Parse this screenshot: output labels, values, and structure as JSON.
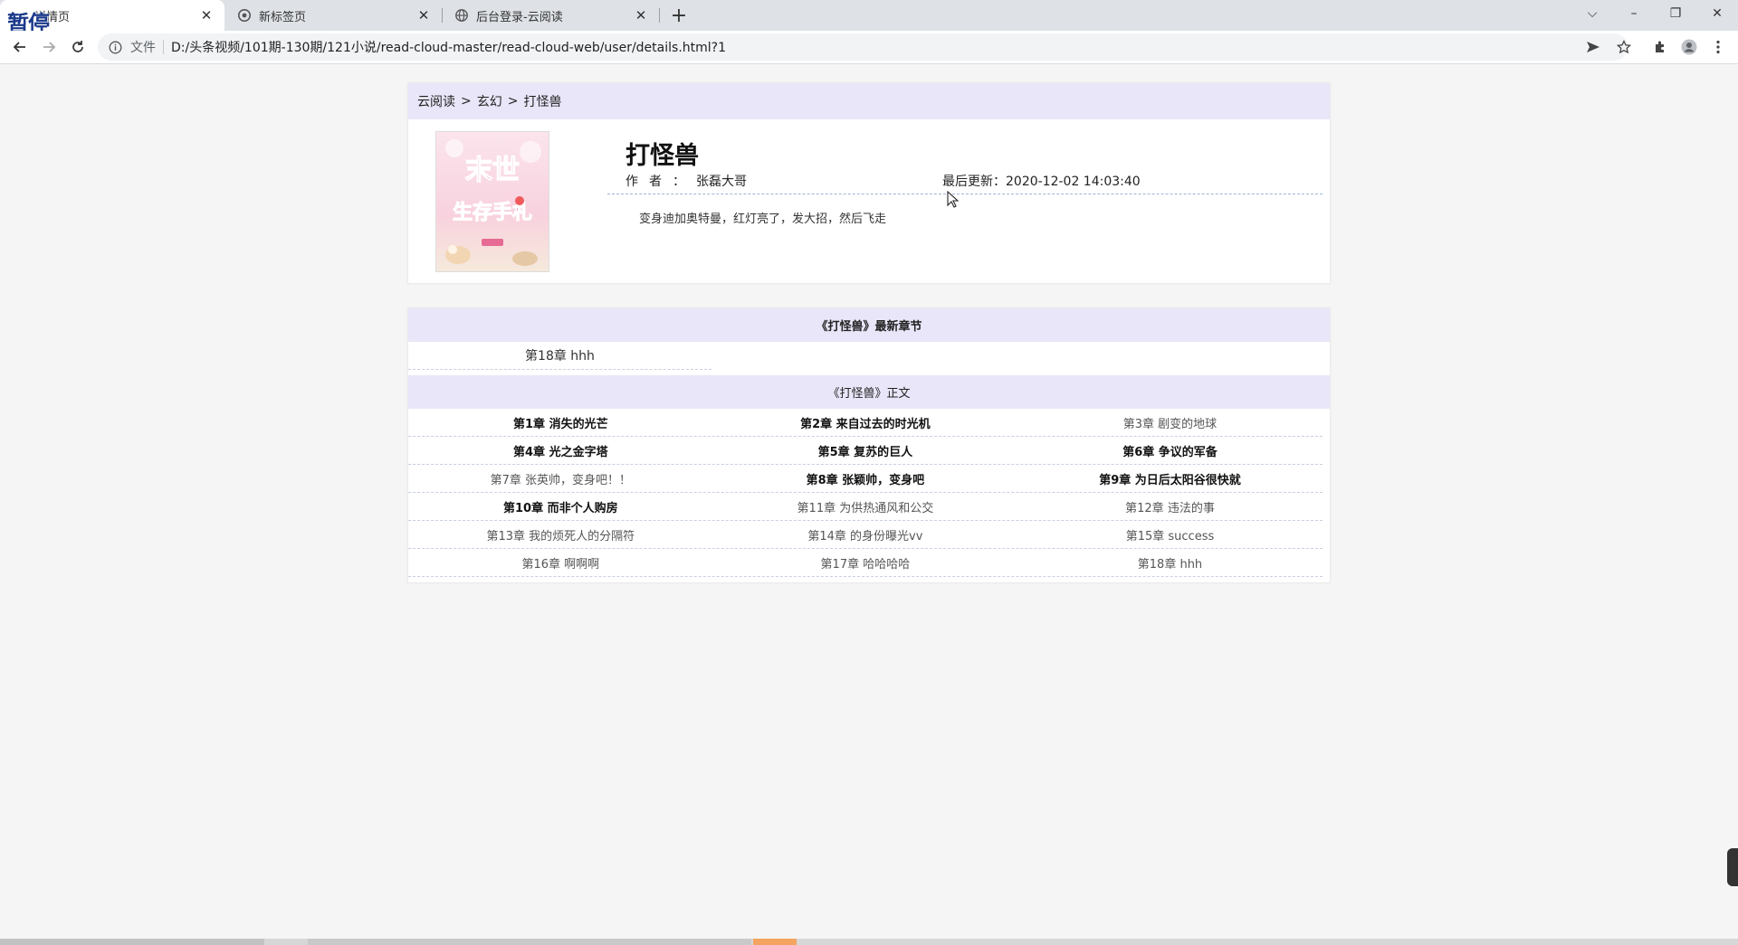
{
  "browser": {
    "tabs": [
      {
        "title": "详情页",
        "active": true
      },
      {
        "title": "新标签页",
        "active": false
      },
      {
        "title": "后台登录-云阅读",
        "active": false
      }
    ],
    "paused_label": "暂停",
    "url_scheme": "文件",
    "url": "D:/头条视频/101期-130期/121小说/read-cloud-master/read-cloud-web/user/details.html?1",
    "new_tab_symbol": "+",
    "window_controls": {
      "tab_search": "⌵",
      "minimize": "–",
      "restore": "❐",
      "close": "✕"
    }
  },
  "breadcrumb": {
    "home": "云阅读",
    "separator": ">",
    "category": "玄幻",
    "current": "打怪兽"
  },
  "book": {
    "title": "打怪兽",
    "author_label": "作者：",
    "author": "张磊大哥",
    "updated_label": "最后更新：",
    "updated": "2020-12-02 14:03:40",
    "description": "变身迪加奥特曼，红灯亮了，发大招，然后飞走",
    "cover_text": "末世",
    "cover_text2": "生存手札"
  },
  "latest": {
    "heading": "《打怪兽》最新章节",
    "chapter": "第18章 hhh"
  },
  "main_text": {
    "heading": "《打怪兽》正文",
    "chapters": [
      {
        "label": "第1章 消失的光芒",
        "style": "bold"
      },
      {
        "label": "第2章 来自过去的时光机",
        "style": "bold"
      },
      {
        "label": "第3章 剧变的地球",
        "style": "read"
      },
      {
        "label": "第4章 光之金字塔",
        "style": "bold"
      },
      {
        "label": "第5章 复苏的巨人",
        "style": "bold"
      },
      {
        "label": "第6章 争议的军备",
        "style": "bold"
      },
      {
        "label": "第7章 张英帅，变身吧！！",
        "style": "read"
      },
      {
        "label": "第8章 张颖帅，变身吧",
        "style": "bold"
      },
      {
        "label": "第9章 为日后太阳谷很快就",
        "style": "bold"
      },
      {
        "label": "第10章 而非个人购房",
        "style": "bold"
      },
      {
        "label": "第11章 为供热通风和公交",
        "style": "read"
      },
      {
        "label": "第12章 违法的事",
        "style": "read"
      },
      {
        "label": "第13章 我的烦死人的分隔符",
        "style": "read"
      },
      {
        "label": "第14章 的身份曝光vv",
        "style": "read"
      },
      {
        "label": "第15章 success",
        "style": "read"
      },
      {
        "label": "第16章 啊啊啊",
        "style": "read"
      },
      {
        "label": "第17章 哈哈哈哈",
        "style": "read"
      },
      {
        "label": "第18章 hhh",
        "style": "read"
      }
    ]
  }
}
